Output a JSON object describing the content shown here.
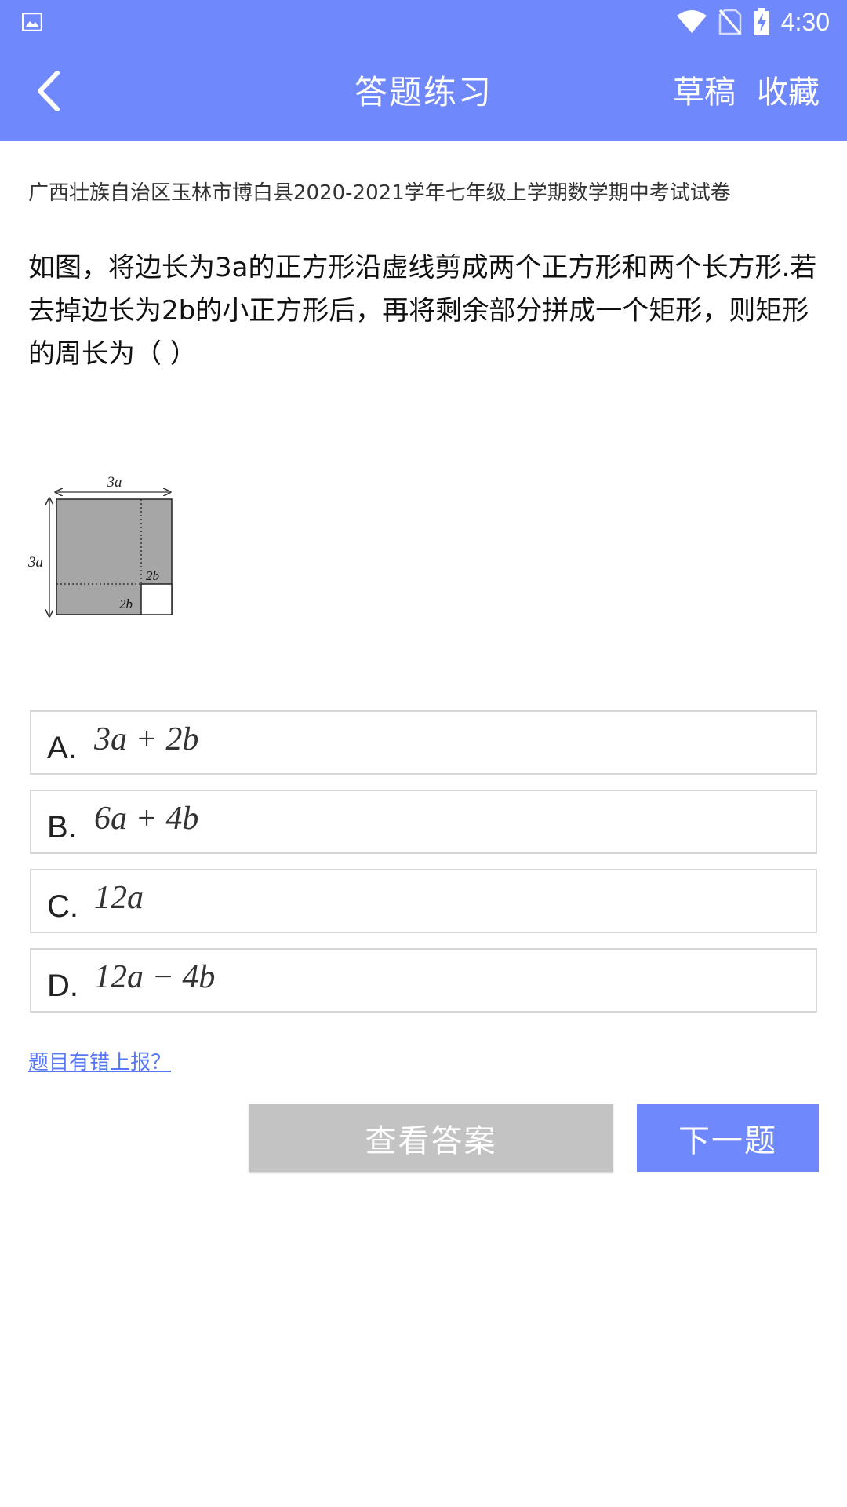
{
  "status_bar": {
    "time": "4:30",
    "icons": [
      "gallery-icon",
      "wifi-icon",
      "no-sim-icon",
      "battery-charging-icon"
    ]
  },
  "toolbar": {
    "back_icon": "chevron-left-icon",
    "title": "答题练习",
    "draft_label": "草稿",
    "favorite_label": "收藏"
  },
  "question": {
    "source": "广西壮族自治区玉林市博白县2020-2021学年七年级上学期数学期中考试试卷",
    "text": "如图，将边长为3a的正方形沿虚线剪成两个正方形和两个长方形.若去掉边长为2b的小正方形后，再将剩余部分拼成一个矩形，则矩形的周长为（    ）",
    "figure_labels": {
      "top": "3a",
      "left": "3a",
      "inner_right": "2b",
      "inner_bottom": "2b"
    }
  },
  "options": [
    {
      "letter": "A.",
      "expr": "3a + 2b"
    },
    {
      "letter": "B.",
      "expr": "6a + 4b"
    },
    {
      "letter": "C.",
      "expr": "12a"
    },
    {
      "letter": "D.",
      "expr": "12a − 4b"
    }
  ],
  "actions": {
    "report_label": "题目有错上报？",
    "view_answer_label": "查看答案",
    "next_label": "下一题"
  },
  "colors": {
    "brand": "#6f88fb",
    "disabled_button": "#c3c3c3",
    "link": "#5877f5",
    "figure_fill": "#a6a6a6"
  }
}
